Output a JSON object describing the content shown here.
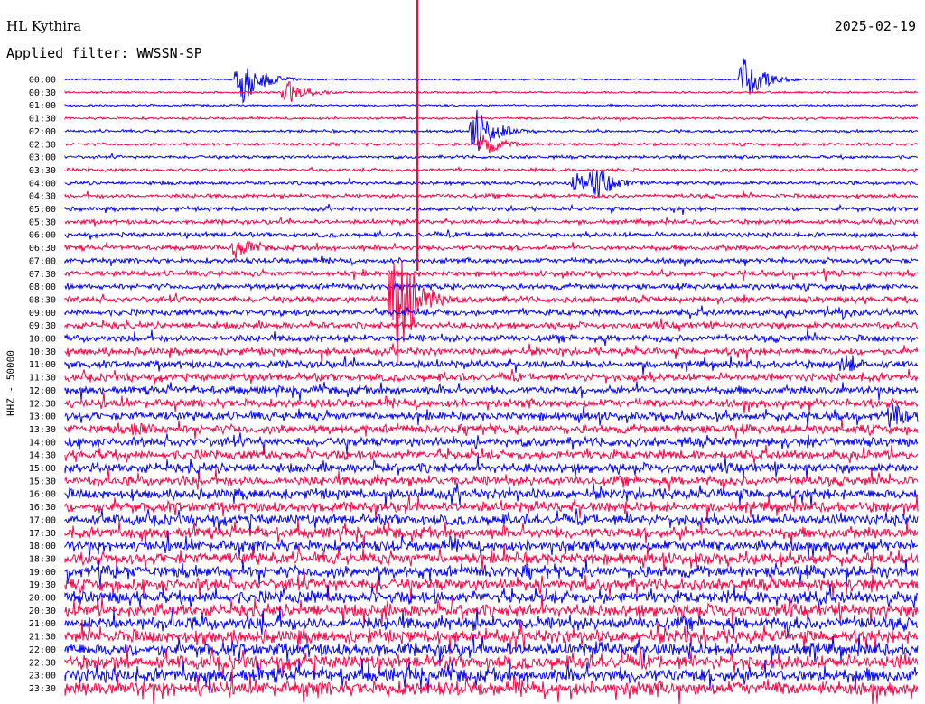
{
  "header": {
    "station": "HL Kythira",
    "date": "2025-02-19",
    "filter": "Applied filter: WWSSN-SP"
  },
  "colors": {
    "blue": "#0000ff",
    "red": "#ff0044"
  },
  "chart_data": {
    "type": "line",
    "title": "HL Kythira",
    "ylabel": "HHZ - 50000",
    "row_labels": [
      "00:00",
      "00:30",
      "01:00",
      "01:30",
      "02:00",
      "02:30",
      "03:00",
      "03:30",
      "04:00",
      "04:30",
      "05:00",
      "05:30",
      "06:00",
      "06:30",
      "07:00",
      "07:30",
      "08:00",
      "08:30",
      "09:00",
      "09:30",
      "10:00",
      "10:30",
      "11:00",
      "11:30",
      "12:00",
      "12:30",
      "13:00",
      "13:30",
      "14:00",
      "14:30",
      "15:00",
      "15:30",
      "16:00",
      "16:30",
      "17:00",
      "17:30",
      "18:00",
      "18:30",
      "19:00",
      "19:30",
      "20:00",
      "20:30",
      "21:00",
      "21:30",
      "22:00",
      "22:30",
      "23:00",
      "23:30"
    ],
    "line_colors": [
      "blue",
      "red"
    ],
    "events": [
      {
        "row": 0,
        "pos": 0.205,
        "size": 32
      },
      {
        "row": 0,
        "pos": 0.795,
        "size": 26
      },
      {
        "row": 1,
        "pos": 0.26,
        "size": 16
      },
      {
        "row": 4,
        "pos": 0.48,
        "size": 30
      },
      {
        "row": 5,
        "pos": 0.49,
        "size": 14
      },
      {
        "row": 8,
        "pos": 0.62,
        "size": 22
      },
      {
        "row": 8,
        "pos": 0.6,
        "size": 12
      },
      {
        "row": 13,
        "pos": 0.2,
        "size": 14
      },
      {
        "row": 17,
        "pos": 0.385,
        "size": 90
      },
      {
        "row": 18,
        "pos": 0.905,
        "size": 10
      },
      {
        "row": 22,
        "pos": 0.915,
        "size": 12
      },
      {
        "row": 26,
        "pos": 0.97,
        "size": 16
      },
      {
        "row": 27,
        "pos": 0.085,
        "size": 12
      },
      {
        "row": 41,
        "pos": 0.76,
        "size": 10
      }
    ]
  }
}
